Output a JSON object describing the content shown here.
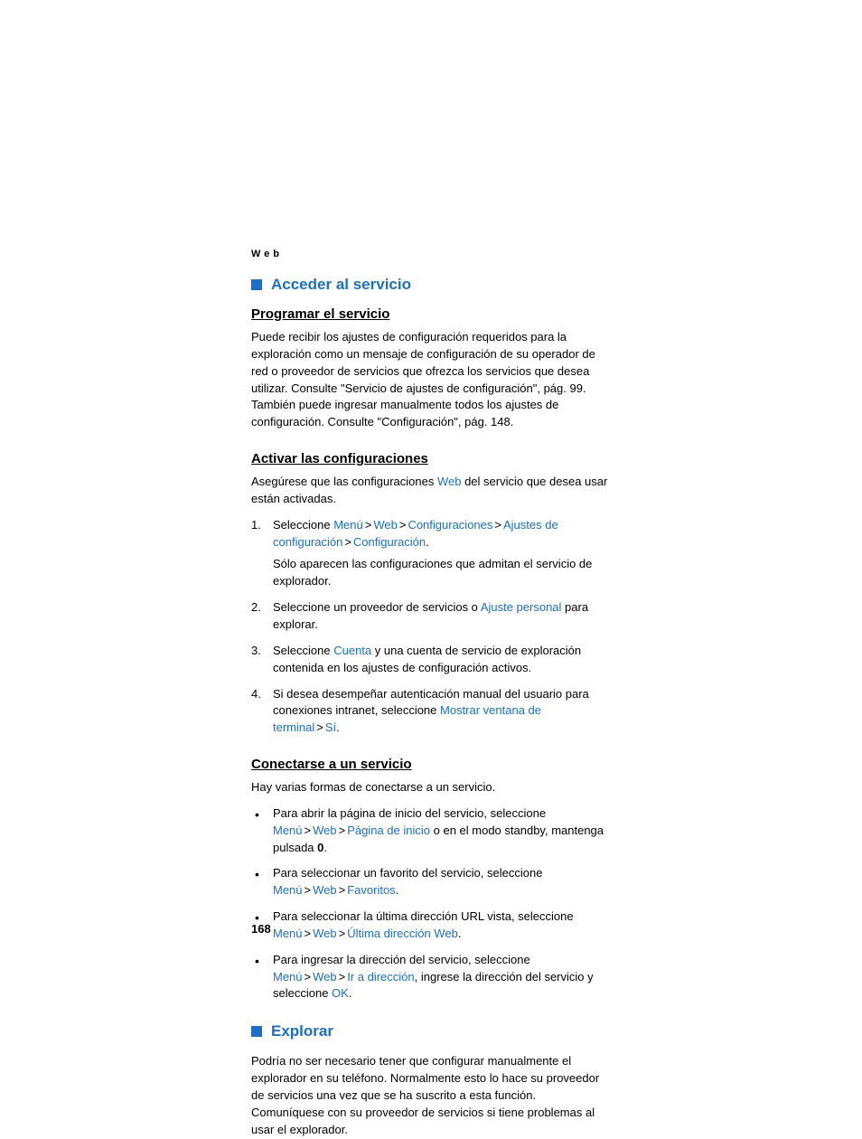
{
  "runningHeader": "Web",
  "section1": {
    "title": "Acceder al servicio",
    "sub1": {
      "title": "Programar el servicio",
      "para": "Puede recibir los ajustes de configuración requeridos para la exploración como un mensaje de configuración de su operador de red o proveedor de servicios que ofrezca los servicios que desea utilizar. Consulte \"Servicio de ajustes de configuración\", pág. 99. También puede ingresar manualmente todos los ajustes de configuración. Consulte \"Configuración\", pág. 148."
    },
    "sub2": {
      "title": "Activar las configuraciones",
      "intro_a": "Asegúrese que las configuraciones ",
      "intro_link": "Web",
      "intro_b": " del servicio que desea usar están activadas.",
      "item1_a": "Seleccione ",
      "item1_l1": "Menú",
      "item1_l2": "Web",
      "item1_l3": "Configuraciones",
      "item1_l4": "Ajustes de configuración",
      "item1_l5": "Configuración",
      "item1_note": "Sólo aparecen las configuraciones que admitan el servicio de explorador.",
      "item2_a": "Seleccione un proveedor de servicios o ",
      "item2_l1": "Ajuste personal",
      "item2_b": " para explorar.",
      "item3_a": "Seleccione ",
      "item3_l1": "Cuenta",
      "item3_b": " y una cuenta de servicio de exploración contenida en los ajustes de configuración activos.",
      "item4_a": "Si desea desempeñar autenticación manual del usuario para conexiones intranet, seleccione ",
      "item4_l1": "Mostrar ventana de terminal",
      "item4_l2": "Sí"
    },
    "sub3": {
      "title": "Conectarse a un servicio",
      "intro": "Hay varias formas de conectarse a un servicio.",
      "b1_a": "Para abrir la página de inicio del servicio, seleccione ",
      "b1_l1": "Menú",
      "b1_l2": "Web",
      "b1_l3": "Página de inicio",
      "b1_b": " o en el modo standby, mantenga pulsada ",
      "b1_key": "0",
      "b2_a": "Para seleccionar un favorito del servicio, seleccione ",
      "b2_l1": "Menú",
      "b2_l2": "Web",
      "b2_l3": "Favoritos",
      "b3_a": "Para seleccionar la última dirección URL vista, seleccione ",
      "b3_l1": "Menú",
      "b3_l2": "Web",
      "b3_l3": "Última dirección Web",
      "b4_a": "Para ingresar la dirección del servicio, seleccione ",
      "b4_l1": "Menú",
      "b4_l2": "Web",
      "b4_l3": "Ir a dirección",
      "b4_b": ", ingrese la dirección del servicio y seleccione ",
      "b4_l4": "OK"
    }
  },
  "section2": {
    "title": "Explorar",
    "para": "Podría no ser necesario tener que configurar manualmente el explorador en su teléfono. Normalmente esto lo hace su proveedor de servicios una vez que se ha suscrito a esta función. Comuníquese con su proveedor de servicios si tiene problemas al usar el explorador."
  },
  "gt": ">",
  "period": ".",
  "pageNumber": "168"
}
